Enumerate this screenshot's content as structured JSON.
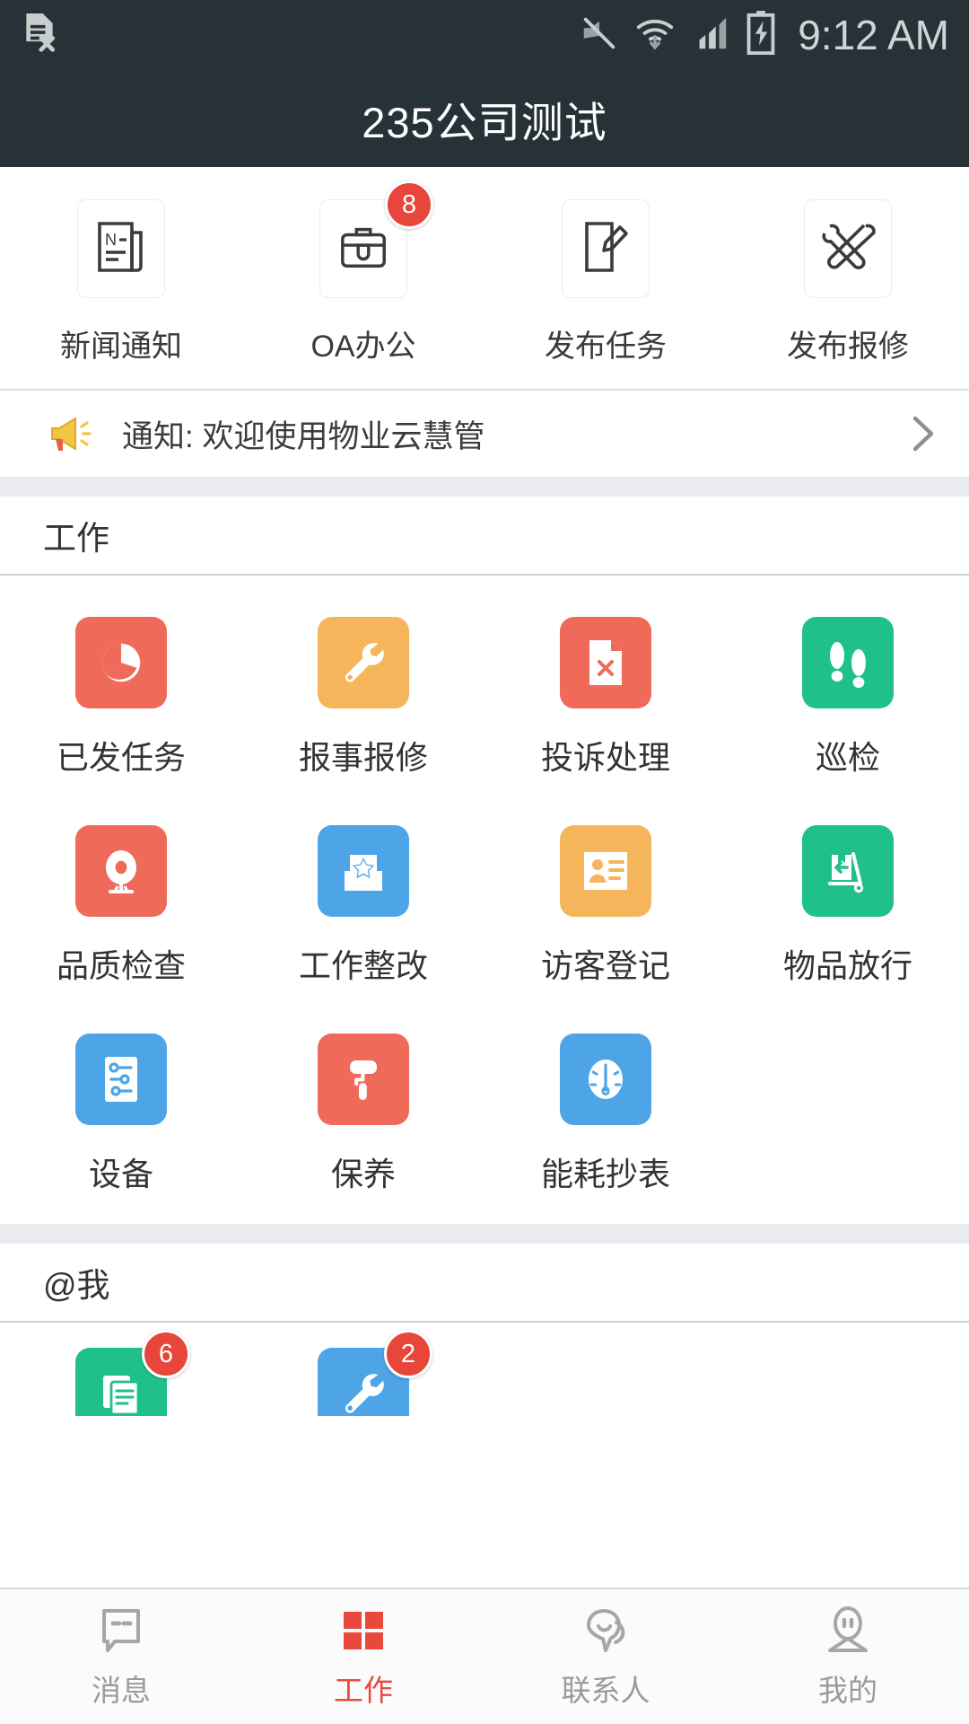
{
  "status_bar": {
    "time": "9:12 AM",
    "icons": [
      "sim-card-error-icon",
      "mute-icon",
      "wifi-icon",
      "signal-icon",
      "battery-charging-icon"
    ]
  },
  "header": {
    "title": "235公司测试"
  },
  "quick_actions": [
    {
      "label": "新闻通知",
      "icon": "news-icon",
      "badge": null
    },
    {
      "label": "OA办公",
      "icon": "briefcase-icon",
      "badge": "8"
    },
    {
      "label": "发布任务",
      "icon": "edit-document-icon",
      "badge": null
    },
    {
      "label": "发布报修",
      "icon": "tools-icon",
      "badge": null
    }
  ],
  "notice": {
    "icon": "megaphone-icon",
    "text": "通知: 欢迎使用物业云慧管",
    "arrow": "chevron-right-icon"
  },
  "sections": [
    {
      "title": "工作",
      "items": [
        {
          "label": "已发任务",
          "icon": "pie-chart-icon",
          "color": "#ef6a58"
        },
        {
          "label": "报事报修",
          "icon": "wrench-icon",
          "color": "#f5b55a"
        },
        {
          "label": "投诉处理",
          "icon": "file-x-icon",
          "color": "#ef6a58"
        },
        {
          "label": "巡检",
          "icon": "footprints-icon",
          "color": "#1fc08a"
        },
        {
          "label": "品质检查",
          "icon": "camera-dome-icon",
          "color": "#ef6a58"
        },
        {
          "label": "工作整改",
          "icon": "star-bag-icon",
          "color": "#4da5e8"
        },
        {
          "label": "访客登记",
          "icon": "id-card-icon",
          "color": "#f5b55a"
        },
        {
          "label": "物品放行",
          "icon": "hand-truck-icon",
          "color": "#1fc08a"
        },
        {
          "label": "设备",
          "icon": "sliders-icon",
          "color": "#4da5e8"
        },
        {
          "label": "保养",
          "icon": "paint-roller-icon",
          "color": "#ef6a58"
        },
        {
          "label": "能耗抄表",
          "icon": "gauge-icon",
          "color": "#4da5e8"
        }
      ]
    },
    {
      "title": "@我",
      "items": [
        {
          "label": "",
          "icon": "documents-icon",
          "color": "#1fc08a",
          "badge": "6"
        },
        {
          "label": "",
          "icon": "wrench-icon",
          "color": "#4da5e8",
          "badge": "2"
        }
      ]
    }
  ],
  "tabbar": [
    {
      "label": "消息",
      "icon": "chat-bubble-icon",
      "active": false
    },
    {
      "label": "工作",
      "icon": "grid-squares-icon",
      "active": true
    },
    {
      "label": "联系人",
      "icon": "contacts-icon",
      "active": false
    },
    {
      "label": "我的",
      "icon": "person-icon",
      "active": false
    }
  ],
  "colors": {
    "accent": "#e8493c",
    "header_bg": "#263238",
    "band_bg": "#eaebef",
    "red": "#ef6a58",
    "orange": "#f5b55a",
    "blue": "#4da5e8",
    "green": "#1fc08a"
  }
}
